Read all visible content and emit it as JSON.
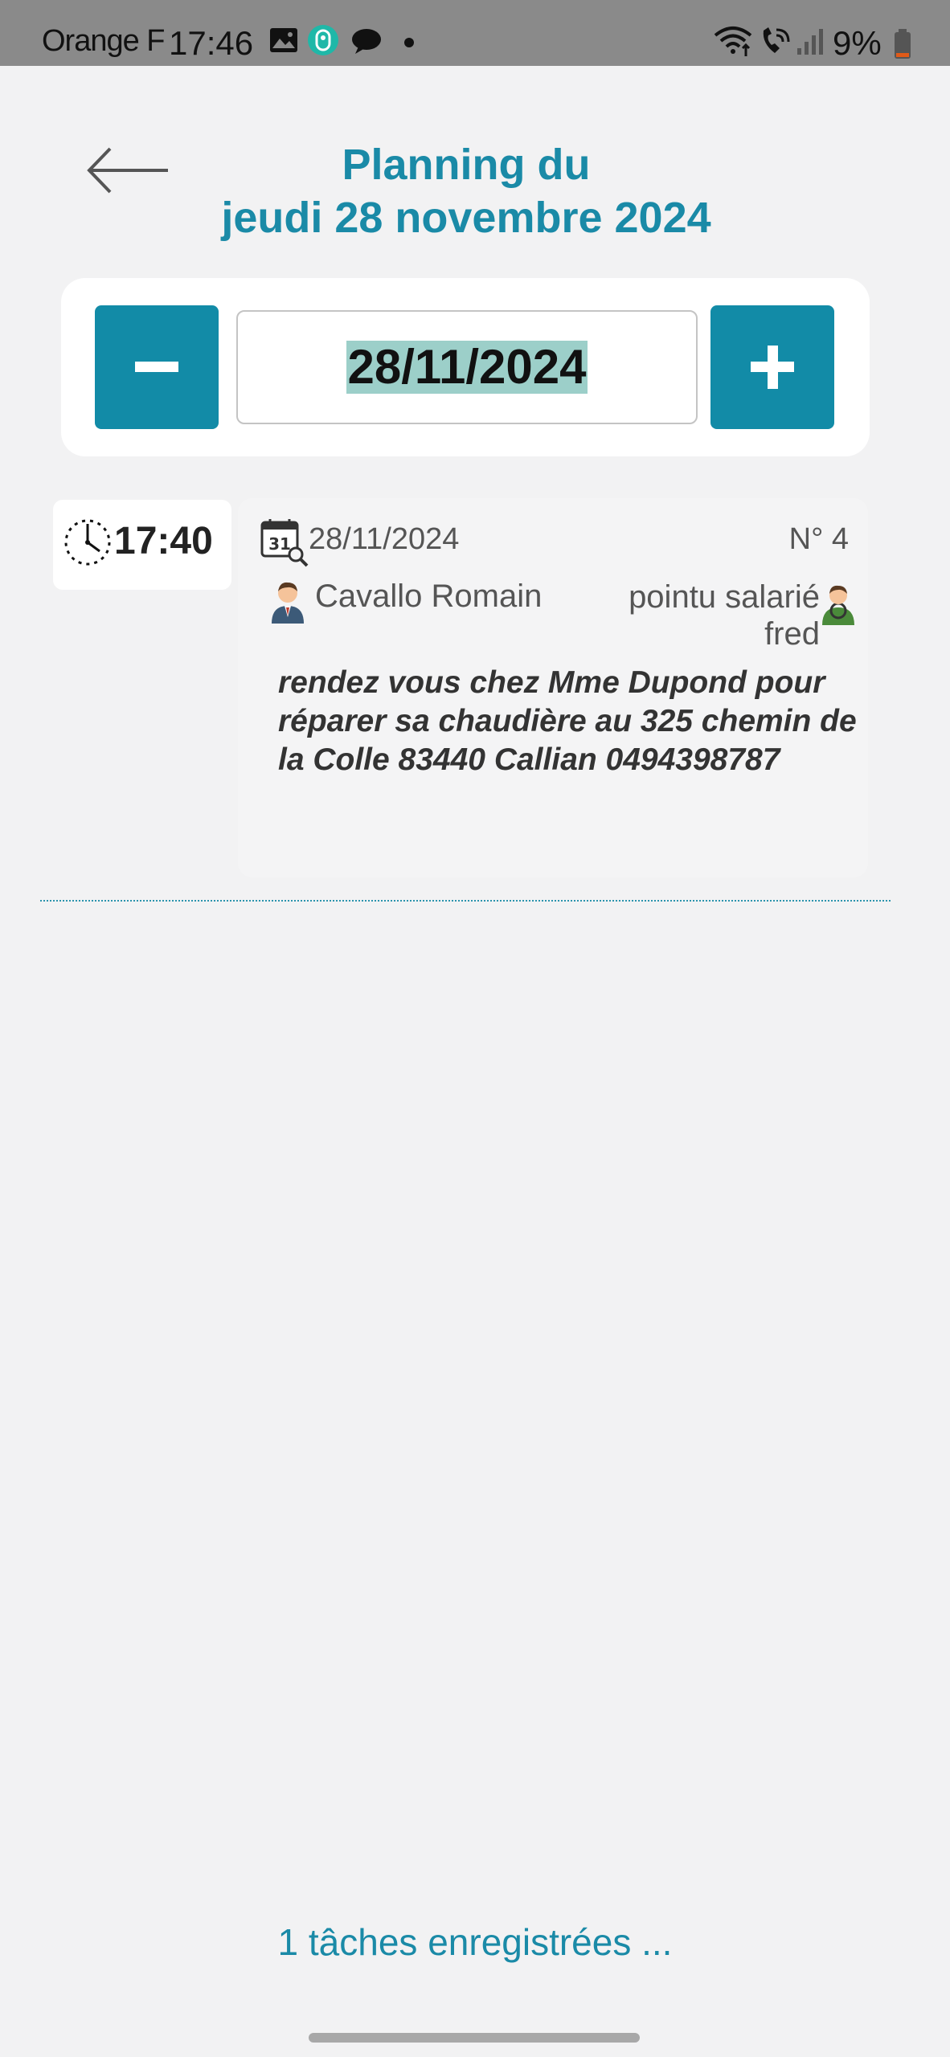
{
  "status_bar": {
    "carrier": "Orange F",
    "time": "17:46",
    "battery": "9%",
    "icons": [
      "image-icon",
      "tracker-icon",
      "chat-icon",
      "dot-icon",
      "wifi-icon",
      "wifi-call-icon",
      "signal-icon",
      "battery-icon"
    ]
  },
  "header": {
    "title_line1": "Planning du",
    "title_line2": "jeudi 28 novembre 2024"
  },
  "date_selector": {
    "value": "28/11/2024"
  },
  "task": {
    "time": "17:40",
    "date": "28/11/2024",
    "number": "N° 4",
    "client": "Cavallo Romain",
    "worker_line1": "pointu salarié",
    "worker_line2": "fred",
    "description": "rendez vous chez Mme Dupond pour réparer sa chaudière au 325 chemin de la Colle 83440 Callian 0494398787"
  },
  "footer": {
    "count_text": "1 tâches enregistrées ..."
  },
  "colors": {
    "accent": "#128ba7",
    "title": "#1a8aa7",
    "background": "#f2f2f3",
    "selection": "#9ccfc9"
  }
}
